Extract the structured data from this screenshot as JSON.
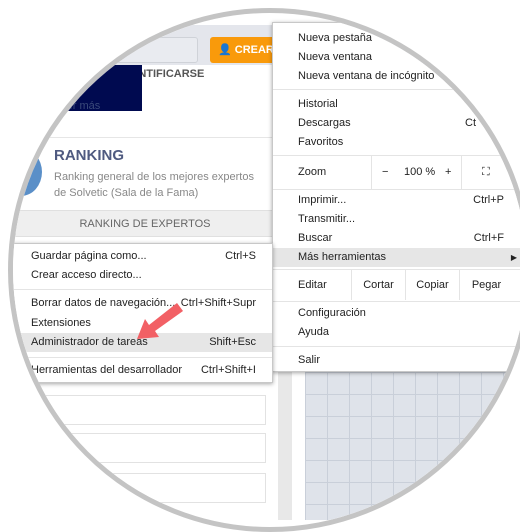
{
  "page": {
    "login_label": "IDENTIFICARSE",
    "create_label": "CREAR C",
    "read_more": "ocer más",
    "ranking_title": "RANKING",
    "ranking_desc": "Ranking general de los mejores expertos de Solvetic (Sala de la Fama)",
    "ranking_button": "RANKING DE EXPERTOS"
  },
  "menu": {
    "new_tab": "Nueva pestaña",
    "new_window": "Nueva ventana",
    "incognito": "Nueva ventana de incógnito",
    "history": "Historial",
    "downloads": "Descargas",
    "downloads_shortcut": "Ct",
    "bookmarks": "Favoritos",
    "zoom": "Zoom",
    "zoom_minus": "−",
    "zoom_value": "100 %",
    "zoom_plus": "+",
    "print": "Imprimir...",
    "print_shortcut": "Ctrl+P",
    "cast": "Transmitir...",
    "find": "Buscar",
    "find_shortcut": "Ctrl+F",
    "more_tools": "Más herramientas",
    "edit": "Editar",
    "cut": "Cortar",
    "copy": "Copiar",
    "paste": "Pegar",
    "settings": "Configuración",
    "help": "Ayuda",
    "exit": "Salir"
  },
  "submenu": {
    "save_page": "Guardar página como...",
    "save_shortcut": "Ctrl+S",
    "shortcut": "Crear acceso directo...",
    "clear_data": "Borrar datos de navegación...",
    "clear_shortcut": "Ctrl+Shift+Supr",
    "extensions": "Extensiones",
    "task_manager": "Administrador de tareas",
    "task_shortcut": "Shift+Esc",
    "devtools": "Herramientas del desarrollador",
    "devtools_shortcut": "Ctrl+Shift+I"
  },
  "colors": {
    "accent": "#f99a0b",
    "arrow": "#f26065",
    "navy": "#000a50",
    "highlight": "#e6e6e6"
  }
}
